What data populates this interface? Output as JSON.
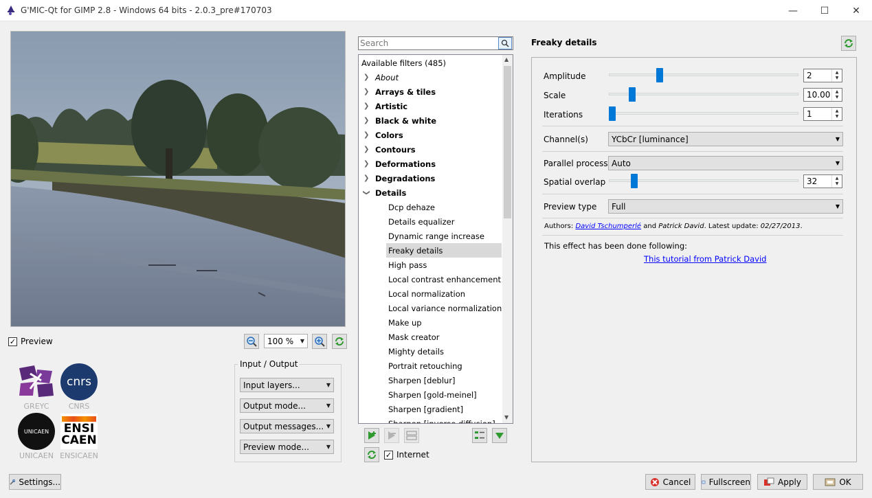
{
  "window": {
    "title": "G'MIC-Qt for GIMP 2.8 - Windows 64 bits - 2.0.3_pre#170703",
    "minimize": "—",
    "maximize": "☐",
    "close": "✕"
  },
  "preview": {
    "checkbox_label": "Preview",
    "checked": "✓",
    "zoom": "100 %"
  },
  "io": {
    "title": "Input / Output",
    "input_layers": "Input layers...",
    "output_mode": "Output mode...",
    "output_messages": "Output messages...",
    "preview_mode": "Preview mode..."
  },
  "logos": {
    "greyc": "GREYC",
    "cnrs": "CNRS",
    "cnrs_mark": "cnrs",
    "unicaen": "UNICAEN",
    "unicaen_mark": "UNICAEN",
    "ensicaen": "ENSICAEN",
    "ensi_line1": "ENSI",
    "ensi_line2": "CAEN"
  },
  "filters": {
    "search_placeholder": "Search",
    "header": "Available filters (485)",
    "categories": [
      "About",
      "Arrays & tiles",
      "Artistic",
      "Black & white",
      "Colors",
      "Contours",
      "Deformations",
      "Degradations",
      "Details"
    ],
    "details_children": [
      "Dcp dehaze",
      "Details equalizer",
      "Dynamic range increase",
      "Freaky details",
      "High pass",
      "Local contrast enhancement",
      "Local normalization",
      "Local variance normalization",
      "Make up",
      "Mask creator",
      "Mighty details",
      "Portrait retouching",
      "Sharpen [deblur]",
      "Sharpen [gold-meinel]",
      "Sharpen [gradient]",
      "Sharpen [inverse diffusion]"
    ],
    "internet_label": "Internet",
    "internet_checked": "✓"
  },
  "settings": {
    "filter_name": "Freaky details",
    "amplitude": {
      "label": "Amplitude",
      "value": "2",
      "fraction": 0.26
    },
    "scale": {
      "label": "Scale",
      "value": "10.00",
      "fraction": 0.11
    },
    "iterations": {
      "label": "Iterations",
      "value": "1",
      "fraction": 0.0
    },
    "channels": {
      "label": "Channel(s)",
      "value": "YCbCr [luminance]"
    },
    "parallel": {
      "label": "Parallel processing",
      "value": "Auto"
    },
    "overlap": {
      "label": "Spatial overlap",
      "value": "32",
      "fraction": 0.12
    },
    "preview_type": {
      "label": "Preview type",
      "value": "Full"
    },
    "authors_prefix": "Authors: ",
    "author1": "David Tschumperlé",
    "authors_and": " and ",
    "author2": "Patrick David",
    "latest_update": ". Latest update: ",
    "date": "02/27/2013",
    "authors_end": ".",
    "note": "This effect has been done following:",
    "tutorial": "This tutorial from Patrick David"
  },
  "buttons": {
    "settings": "Settings...",
    "cancel": "Cancel",
    "fullscreen": "Fullscreen",
    "apply": "Apply",
    "ok": "OK"
  }
}
